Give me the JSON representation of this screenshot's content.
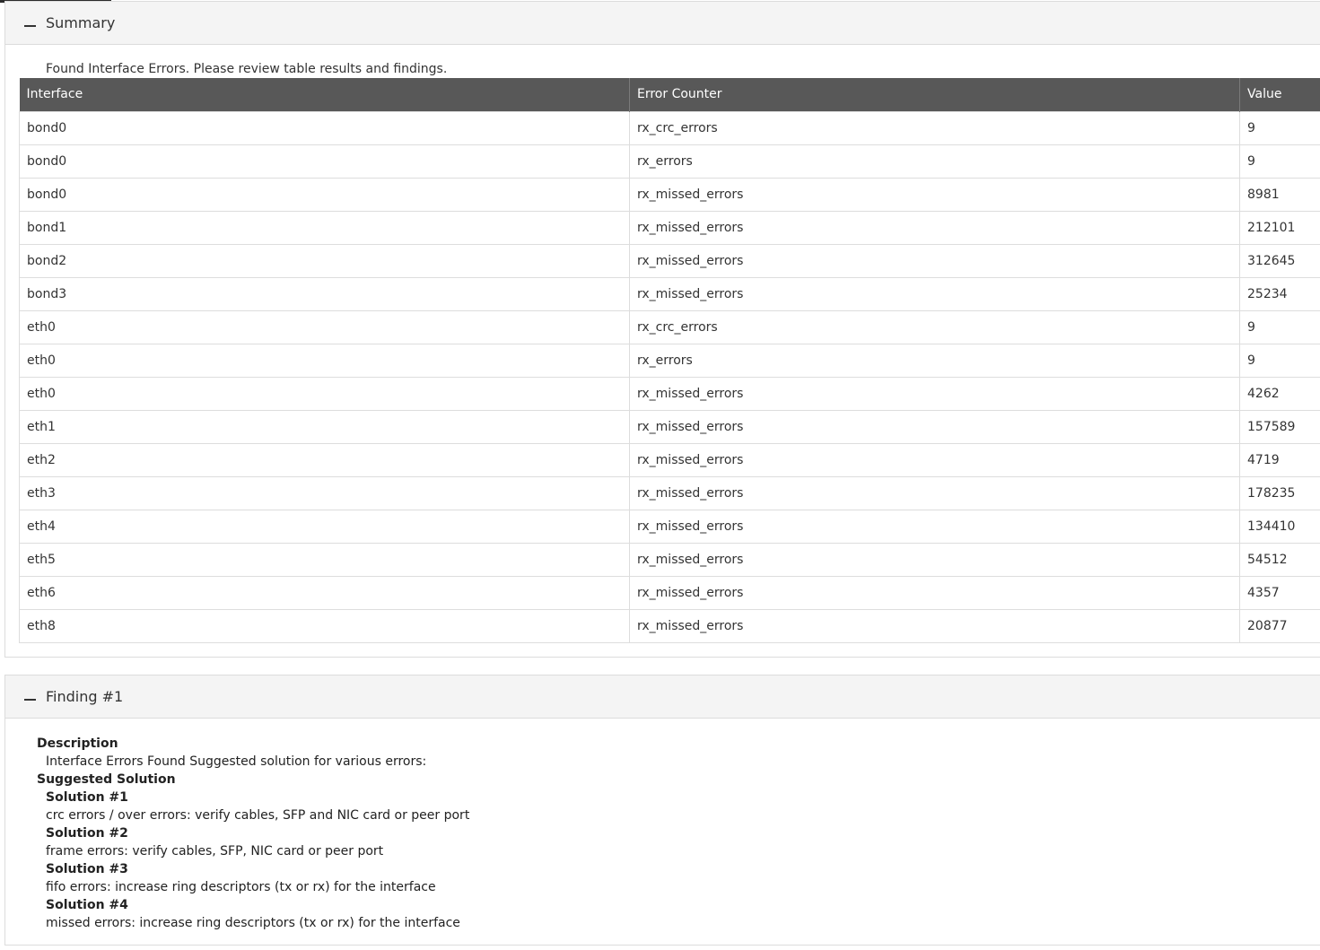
{
  "summary": {
    "title": "Summary",
    "message": "Found Interface Errors. Please review table results and findings.",
    "columns": [
      "Interface",
      "Error Counter",
      "Value"
    ],
    "rows": [
      [
        "bond0",
        "rx_crc_errors",
        "9"
      ],
      [
        "bond0",
        "rx_errors",
        "9"
      ],
      [
        "bond0",
        "rx_missed_errors",
        "8981"
      ],
      [
        "bond1",
        "rx_missed_errors",
        "212101"
      ],
      [
        "bond2",
        "rx_missed_errors",
        "312645"
      ],
      [
        "bond3",
        "rx_missed_errors",
        "25234"
      ],
      [
        "eth0",
        "rx_crc_errors",
        "9"
      ],
      [
        "eth0",
        "rx_errors",
        "9"
      ],
      [
        "eth0",
        "rx_missed_errors",
        "4262"
      ],
      [
        "eth1",
        "rx_missed_errors",
        "157589"
      ],
      [
        "eth2",
        "rx_missed_errors",
        "4719"
      ],
      [
        "eth3",
        "rx_missed_errors",
        "178235"
      ],
      [
        "eth4",
        "rx_missed_errors",
        "134410"
      ],
      [
        "eth5",
        "rx_missed_errors",
        "54512"
      ],
      [
        "eth6",
        "rx_missed_errors",
        "4357"
      ],
      [
        "eth8",
        "rx_missed_errors",
        "20877"
      ]
    ]
  },
  "finding": {
    "title": "Finding #1",
    "description_label": "Description",
    "description_text": "Interface Errors Found Suggested solution for various errors:",
    "solution_label": "Suggested Solution",
    "solutions": [
      {
        "label": "Solution #1",
        "text": "crc errors / over errors: verify cables, SFP and NIC card or peer port"
      },
      {
        "label": "Solution #2",
        "text": "frame errors: verify cables, SFP, NIC card or peer port"
      },
      {
        "label": "Solution #3",
        "text": "fifo errors: increase ring descriptors (tx or rx) for the interface"
      },
      {
        "label": "Solution #4",
        "text": "missed errors: increase ring descriptors (tx or rx) for the interface"
      }
    ]
  }
}
